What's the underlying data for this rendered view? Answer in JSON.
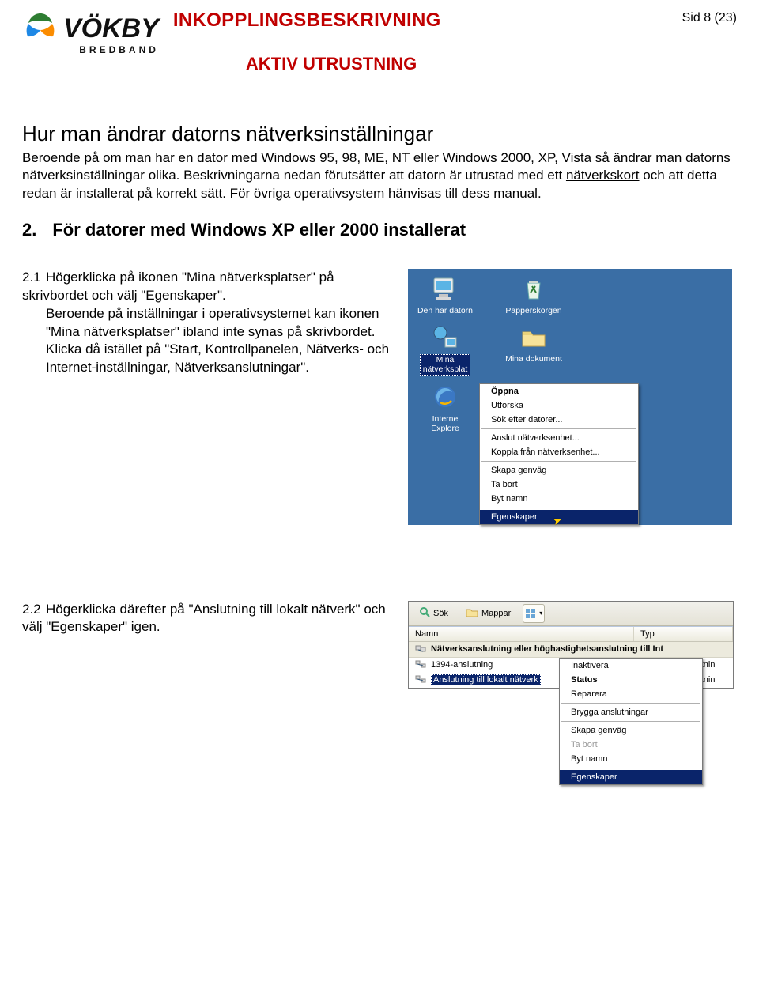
{
  "header": {
    "logo_word": "VÖKBY",
    "logo_sub": "BREDBAND",
    "doc_title": "INKOPPLINGSBESKRIVNING",
    "doc_subtitle": "AKTIV UTRUSTNING",
    "page_number": "Sid 8 (23)"
  },
  "main": {
    "heading": "Hur man ändrar datorns nätverksinställningar",
    "intro_pre_ul": "Beroende på om man har en dator med Windows 95, 98, ME, NT eller Windows 2000, XP, Vista så ändrar man datorns nätverksinställningar olika. Beskrivningarna nedan förutsätter att datorn är utrustad med ett ",
    "intro_ul": "nätverkskort",
    "intro_post_ul": " och att detta redan är installerat på korrekt sätt. För övriga operativsystem hänvisas till dess manual."
  },
  "section2": {
    "num": "2.",
    "title": "För datorer med Windows XP eller 2000 installerat"
  },
  "step21": {
    "num": "2.1",
    "line1": "Högerklicka på ikonen \"Mina nätverksplatser\" på skrivbordet och välj \"Egenskaper\".",
    "line2": "Beroende på inställningar i operativsystemet kan ikonen \"Mina nätverksplatser\" ibland inte synas på skrivbordet.",
    "line3": "Klicka då istället på \"Start, Kontrollpanelen, Nätverks- och Internet-inställningar, Nätverksanslutningar\"."
  },
  "desktop": {
    "icons": {
      "computer": "Den här datorn",
      "recycle": "Papperskorgen",
      "network_line1": "Mina",
      "network_line2": "nätverksplat",
      "documents": "Mina dokument",
      "ie_line1": "Interne",
      "ie_line2": "Explore"
    },
    "context_menu": [
      {
        "label": "Öppna",
        "bold": true
      },
      {
        "label": "Utforska"
      },
      {
        "label": "Sök efter datorer..."
      },
      {
        "sep": true
      },
      {
        "label": "Anslut nätverksenhet..."
      },
      {
        "label": "Koppla från nätverksenhet..."
      },
      {
        "sep": true
      },
      {
        "label": "Skapa genväg"
      },
      {
        "label": "Ta bort"
      },
      {
        "label": "Byt namn"
      },
      {
        "sep": true
      },
      {
        "label": "Egenskaper",
        "hilite": true
      }
    ]
  },
  "step22": {
    "num": "2.2",
    "text": "Högerklicka därefter på \"Anslutning till lokalt nätverk\" och välj \"Egenskaper\" igen."
  },
  "explorer": {
    "toolbar": {
      "search": "Sök",
      "folders": "Mappar"
    },
    "columns": {
      "name": "Namn",
      "type": "Typ"
    },
    "section_header": "Nätverksanslutning eller höghastighetsanslutning till Int",
    "rows": [
      {
        "name": "1394-anslutning",
        "type": "Nätverksanslutnin"
      },
      {
        "name": "Anslutning till lokalt nätverk",
        "type": "Nätverksanslutnin",
        "selected": true
      }
    ],
    "context_menu": [
      {
        "label": "Inaktivera"
      },
      {
        "label": "Status",
        "bold": true
      },
      {
        "label": "Reparera"
      },
      {
        "sep": true
      },
      {
        "label": "Brygga anslutningar"
      },
      {
        "sep": true
      },
      {
        "label": "Skapa genväg"
      },
      {
        "label": "Ta bort",
        "disabled": true
      },
      {
        "label": "Byt namn"
      },
      {
        "sep": true
      },
      {
        "label": "Egenskaper",
        "hilite": true
      }
    ]
  }
}
